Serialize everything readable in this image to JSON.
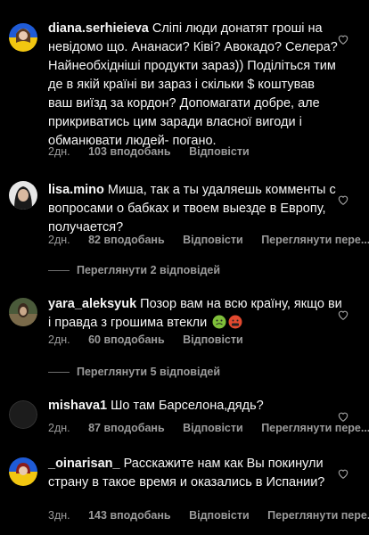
{
  "comments": [
    {
      "username": "diana.serhieieva",
      "text": "Сліпі люди донатят гроші на невідомо що. Ананаси? Ківі? Авокадо? Селера? Найнеобхідніші продукти зараз)) Поділіться тим де в якій країні ви зараз і скільки $ коштував ваш виїзд за кордон? Допомагати добре, але прикриватись цим заради власної вигоди і обманювати людей- погано.",
      "time": "2дн.",
      "likes": "103 вподобань",
      "reply": "Відповісти",
      "translate": ""
    },
    {
      "username": "lisa.mino",
      "text": "Миша, так а ты удаляешь комменты с вопросами о бабках и твоем выезде в Европу, получается?",
      "time": "2дн.",
      "likes": "82 вподобань",
      "reply": "Відповісти",
      "translate": "Переглянути пере...",
      "view_replies": "Переглянути 2 відповідей"
    },
    {
      "username": "yara_aleksyuk",
      "text": "Позор вам на всю країну, якщо ви і правда з грошима втекли",
      "emojis": [
        "nauseated-face-icon",
        "cursing-face-icon"
      ],
      "time": "2дн.",
      "likes": "60 вподобань",
      "reply": "Відповісти",
      "translate": "",
      "view_replies": "Переглянути 5 відповідей"
    },
    {
      "username": "mishava1",
      "text": "Шо там Барселона,дядь?",
      "time": "2дн.",
      "likes": "87 вподобань",
      "reply": "Відповісти",
      "translate": "Переглянути пере..."
    },
    {
      "username": "_oinarisan_",
      "text": "Расскажите нам как Вы покинули страну в такое время и оказались в Испании?",
      "time": "3дн.",
      "likes": "143 вподобань",
      "reply": "Відповісти",
      "translate": "Переглянути пере..."
    }
  ],
  "icons": {
    "like": "heart-outline-icon"
  },
  "colors": {
    "background": "#000000",
    "text": "#f5f5f5",
    "meta": "#9b9b9b",
    "ukraine_blue": "#1f5bd6",
    "ukraine_yellow": "#f2c611"
  }
}
